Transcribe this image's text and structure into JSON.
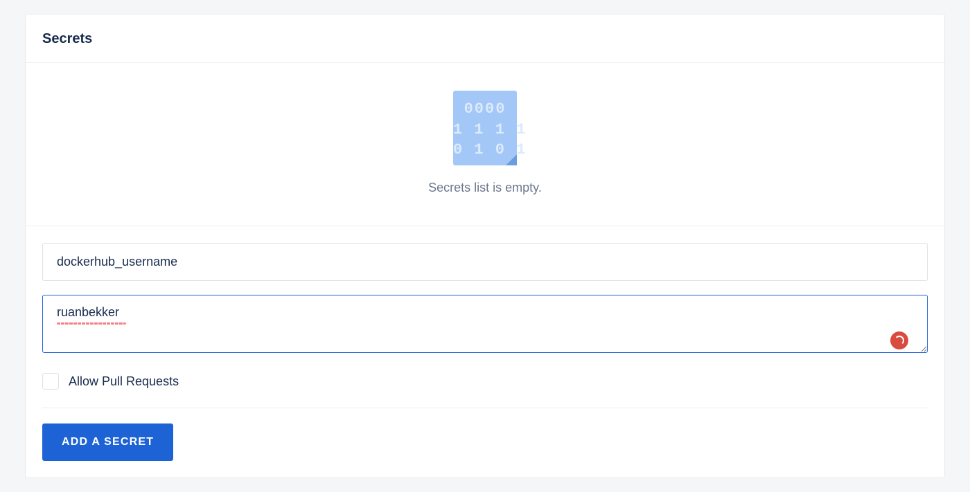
{
  "panel": {
    "title": "Secrets",
    "empty_message": "Secrets list is empty.",
    "illustration_lines": "0000\n1 1 1 1\n0 1 0 1"
  },
  "form": {
    "secret_name_value": "dockerhub_username",
    "secret_value_value": "ruanbekker",
    "allow_pr_label": "Allow Pull Requests",
    "allow_pr_checked": false,
    "submit_label": "ADD A SECRET"
  },
  "icons": {
    "loader": "loading-spinner"
  }
}
